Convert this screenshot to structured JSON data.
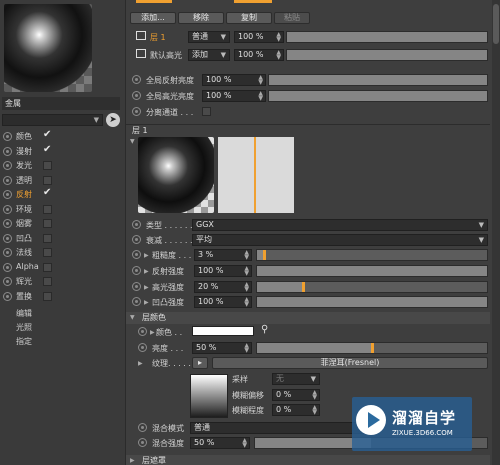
{
  "left_panel": {
    "material_name": "金属",
    "channels": [
      {
        "label": "颜色",
        "checked": true,
        "active": false
      },
      {
        "label": "漫射",
        "checked": true,
        "active": false
      },
      {
        "label": "发光",
        "checked": false,
        "active": false
      },
      {
        "label": "透明",
        "checked": false,
        "active": false
      },
      {
        "label": "反射",
        "checked": true,
        "active": true
      },
      {
        "label": "环境",
        "checked": false,
        "active": false
      },
      {
        "label": "烟雾",
        "checked": false,
        "active": false
      },
      {
        "label": "凹凸",
        "checked": false,
        "active": false
      },
      {
        "label": "法线",
        "checked": false,
        "active": false
      },
      {
        "label": "Alpha",
        "checked": false,
        "active": false
      },
      {
        "label": "辉光",
        "checked": false,
        "active": false
      },
      {
        "label": "置换",
        "checked": false,
        "active": false
      }
    ],
    "extra_items": [
      "编辑",
      "光照",
      "指定"
    ]
  },
  "toolbar": {
    "add": "添加...",
    "remove": "移除",
    "copy": "复制",
    "paste": "粘贴"
  },
  "layers": {
    "layer1": {
      "name": "层 1",
      "mode": "普通",
      "value": "100 %"
    },
    "default": {
      "name": "默认高光",
      "mode": "添加",
      "value": "100 %"
    }
  },
  "global": {
    "reflect_label": "全局反射亮度",
    "reflect_value": "100 %",
    "spec_label": "全局高光亮度",
    "spec_value": "100 %",
    "separate_label": "分离通道 . . ."
  },
  "layer_section": {
    "title": "层 1",
    "type_label": "类型 . . . . . . . . . .",
    "type_value": "GGX",
    "atten_label": "衰减 . . . . . . . . . .",
    "atten_value": "平均",
    "roughness_label": "粗糙度 . . .",
    "roughness_value": "3 %",
    "roughness_level": 0.03,
    "reflect_strength_label": "反射强度",
    "reflect_strength_value": "100 %",
    "reflect_strength_level": 1.0,
    "spec_strength_label": "高光强度",
    "spec_strength_value": "20 %",
    "spec_strength_level": 0.2,
    "bump_strength_label": "凹凸强度",
    "bump_strength_value": "100 %",
    "bump_strength_level": 1.0
  },
  "layer_color": {
    "header": "层颜色",
    "color_label": "颜色 . .",
    "brightness_label": "亮度 . . .",
    "brightness_value": "50 %",
    "brightness_level": 0.5,
    "texture_label": "纹理. . . . .",
    "texture_value": "菲涅耳(Fresnel)",
    "sample_label": "采样",
    "sample_value": "无",
    "blur_offset_label": "模糊偏移",
    "blur_offset_value": "0 %",
    "blur_level_label": "模糊程度",
    "blur_level_value": "0 %",
    "blend_mode_label": "混合模式",
    "blend_mode_value": "普通",
    "blend_strength_label": "混合强度",
    "blend_strength_value": "50 %",
    "blend_strength_level": 0.5
  },
  "layer_mask": {
    "header": "层遮罩"
  },
  "watermark": {
    "title": "溜溜自学",
    "url": "ZIXUE.3D66.COM"
  },
  "colors": {
    "accent": "#f0a030",
    "panel": "#3e3e3e",
    "field": "#2d2d2d"
  }
}
